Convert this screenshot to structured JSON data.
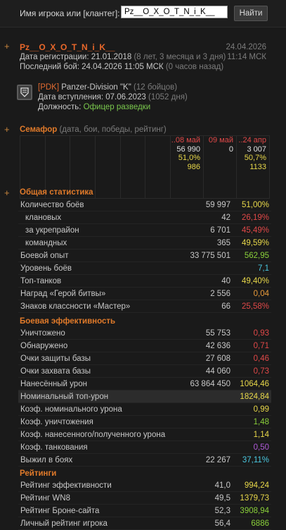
{
  "search": {
    "label": "Имя игрока или [клантег]:",
    "value": "Pz__O_X_O_T_N_i_K__",
    "button": "Найти"
  },
  "player": {
    "name": "Pz__O_X_O_T_N_i_K__",
    "date": "24.04.2026",
    "time": "11:14 МСК",
    "reg_label": "Дата регистрации: 21.01.2018",
    "reg_age": "(8 лет, 3 месяца и 3 дня)",
    "last_label": "Последний бой: 24.04.2026 11:05 МСК",
    "last_age": "(0 часов назад)"
  },
  "clan": {
    "tag": "[PDK]",
    "name": "Panzer-Division \"K\"",
    "members": "(12 бойцов)",
    "join_label": "Дата вступления: 07.06.2023",
    "join_days": "(1052 дня)",
    "role_label": "Должность:",
    "role": "Офицер разведки"
  },
  "semafor": {
    "title": "Семафор",
    "subtitle": "(дата, бои, победы, рейтинг)",
    "columns": [
      {
        "date": "..08 май",
        "battles": "56 990",
        "wins": "51,0%",
        "rating": "986"
      },
      {
        "date": "09 май",
        "battles": "0",
        "wins": "",
        "rating": ""
      },
      {
        "date": "..24 апр",
        "battles": "3 007",
        "wins": "50,7%",
        "rating": "1133"
      }
    ]
  },
  "general": {
    "title": "Общая статистика",
    "rows": [
      {
        "label": "Количество боёв",
        "num": "59 997",
        "val": "51,00%",
        "color": "#e8d84a",
        "indent": false
      },
      {
        "label": "клановых",
        "num": "42",
        "val": "26,19%",
        "color": "#e04848",
        "indent": true
      },
      {
        "label": "за укрепрайон",
        "num": "6 701",
        "val": "45,49%",
        "color": "#e04848",
        "indent": true
      },
      {
        "label": "командных",
        "num": "365",
        "val": "49,59%",
        "color": "#e8d84a",
        "indent": true
      },
      {
        "label": "Боевой опыт",
        "num": "33 775 501",
        "val": "562,95",
        "color": "#8ad03a",
        "indent": false
      },
      {
        "label": "Уровень боёв",
        "num": "",
        "val": "7,1",
        "color": "#4ac8e0",
        "indent": false
      },
      {
        "label": "Топ-танков",
        "num": "40",
        "val": "49,40%",
        "color": "#e8d84a",
        "indent": false
      },
      {
        "label": "Наград «Герой битвы»",
        "num": "2 556",
        "val": "0,04",
        "color": "#e89a3a",
        "indent": false
      },
      {
        "label": "Знаков классности «Мастер»",
        "num": "66",
        "val": "25,58%",
        "color": "#e04848",
        "indent": false
      }
    ]
  },
  "efficiency": {
    "title": "Боевая эффективность",
    "rows": [
      {
        "label": "Уничтожено",
        "num": "55 753",
        "val": "0,93",
        "color": "#e04848",
        "hl": false
      },
      {
        "label": "Обнаружено",
        "num": "42 636",
        "val": "0,71",
        "color": "#e04848",
        "hl": false
      },
      {
        "label": "Очки защиты базы",
        "num": "27 608",
        "val": "0,46",
        "color": "#e04848",
        "hl": false
      },
      {
        "label": "Очки захвата базы",
        "num": "44 060",
        "val": "0,73",
        "color": "#e04848",
        "hl": false
      },
      {
        "label": "Нанесённый урон",
        "num": "63 864 450",
        "val": "1064,46",
        "color": "#e8d84a",
        "hl": false
      },
      {
        "label": "Номинальный топ-урон",
        "num": "",
        "val": "1824,84",
        "color": "#e8d84a",
        "hl": true
      },
      {
        "label": "Коэф. номинального урона",
        "num": "",
        "val": "0,99",
        "color": "#e8d84a",
        "hl": false
      },
      {
        "label": "Коэф. уничтожения",
        "num": "",
        "val": "1,48",
        "color": "#8ad03a",
        "hl": false
      },
      {
        "label": "Коэф. нанесенного/полученного урона",
        "num": "",
        "val": "1,14",
        "color": "#e8d84a",
        "hl": false
      },
      {
        "label": "Коэф. танкования",
        "num": "",
        "val": "0,50",
        "color": "#b05ad8",
        "hl": false
      },
      {
        "label": "Выжил в боях",
        "num": "22 267",
        "val": "37,11%",
        "color": "#4ac8e0",
        "hl": false
      }
    ]
  },
  "ratings": {
    "title": "Рейтинги",
    "rows": [
      {
        "label": "Рейтинг эффективности",
        "num": "41,0",
        "val": "994,24",
        "color": "#e8d84a"
      },
      {
        "label": "Рейтинг WN8",
        "num": "49,5",
        "val": "1379,73",
        "color": "#e8d84a"
      },
      {
        "label": "Рейтинг Броне-сайта",
        "num": "52,3",
        "val": "3908,94",
        "color": "#8ad03a"
      },
      {
        "label": "Личный рейтинг игрока",
        "num": "56,4",
        "val": "6886",
        "color": "#8ad03a"
      }
    ]
  },
  "icons": {
    "plus": "+",
    "emblem": "clan-emblem-icon"
  }
}
